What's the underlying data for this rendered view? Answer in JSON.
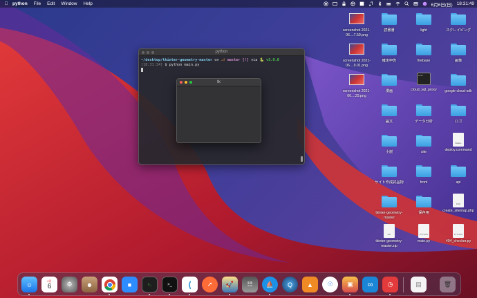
{
  "menubar": {
    "app_name": "python",
    "items": [
      "File",
      "Edit",
      "Window",
      "Help"
    ],
    "date": "6月6日(日)",
    "time": "18:31:49"
  },
  "terminal": {
    "title": "python",
    "prompt_path": "~/desktop/tkinter-geometry-master",
    "prompt_on": "on",
    "branch": "master",
    "branch_status": "[!]",
    "via": "via",
    "version": "v3.9.0",
    "clock": "[18:31:34]",
    "command": "$ python main.py"
  },
  "tk_window": {
    "title": "tk"
  },
  "desktop_icons": [
    {
      "label": "screenshot 2021-06....7.59.png"
    },
    {
      "label": "screenshot 2021-06....9.01.png"
    },
    {
      "label": "screenshot 2021-06....29.png"
    },
    {
      "label": "読書書"
    },
    {
      "label": "light"
    },
    {
      "label": "スクレイピング"
    },
    {
      "label": "確定申告"
    },
    {
      "label": "firebase"
    },
    {
      "label": "画像"
    },
    {
      "label": "漫画"
    },
    {
      "label": "cloud_sql_proxy"
    },
    {
      "label": "google-cloud-sdk"
    },
    {
      "label": "論文"
    },
    {
      "label": "データ分析"
    },
    {
      "label": "ロゴ"
    },
    {
      "label": "小説"
    },
    {
      "label": "site"
    },
    {
      "label": "deploy.command"
    },
    {
      "label": "サイト作成試品物"
    },
    {
      "label": "front"
    },
    {
      "label": "api"
    },
    {
      "label": "tkinter-geometry-master"
    },
    {
      "label": "保存用"
    },
    {
      "label": "create_sitemap.php"
    },
    {
      "label": "tkinter-geometry-master.zip"
    },
    {
      "label": "main.py"
    },
    {
      "label": "404_checker.py"
    }
  ],
  "file_tags": {
    "shell": "SHELL",
    "php": "PHP",
    "zip": "ZIP",
    "python": "PYTHON",
    "exec": "exec"
  },
  "dock": {
    "calendar_month": "6月",
    "calendar_day": "6",
    "apps": [
      "finder",
      "calendar",
      "system-preferences",
      "contacts",
      "chrome",
      "zoom",
      "terminal",
      "terminal-2",
      "vscode",
      "postman",
      "python-launcher",
      "docker",
      "docker-desktop",
      "quicktime",
      "sourcetree",
      "sourcetree-2",
      "preview",
      "arduino",
      "clock",
      "document",
      "trash"
    ]
  },
  "colors": {
    "folder": "#4aa8e8",
    "menubar": "#141428"
  }
}
